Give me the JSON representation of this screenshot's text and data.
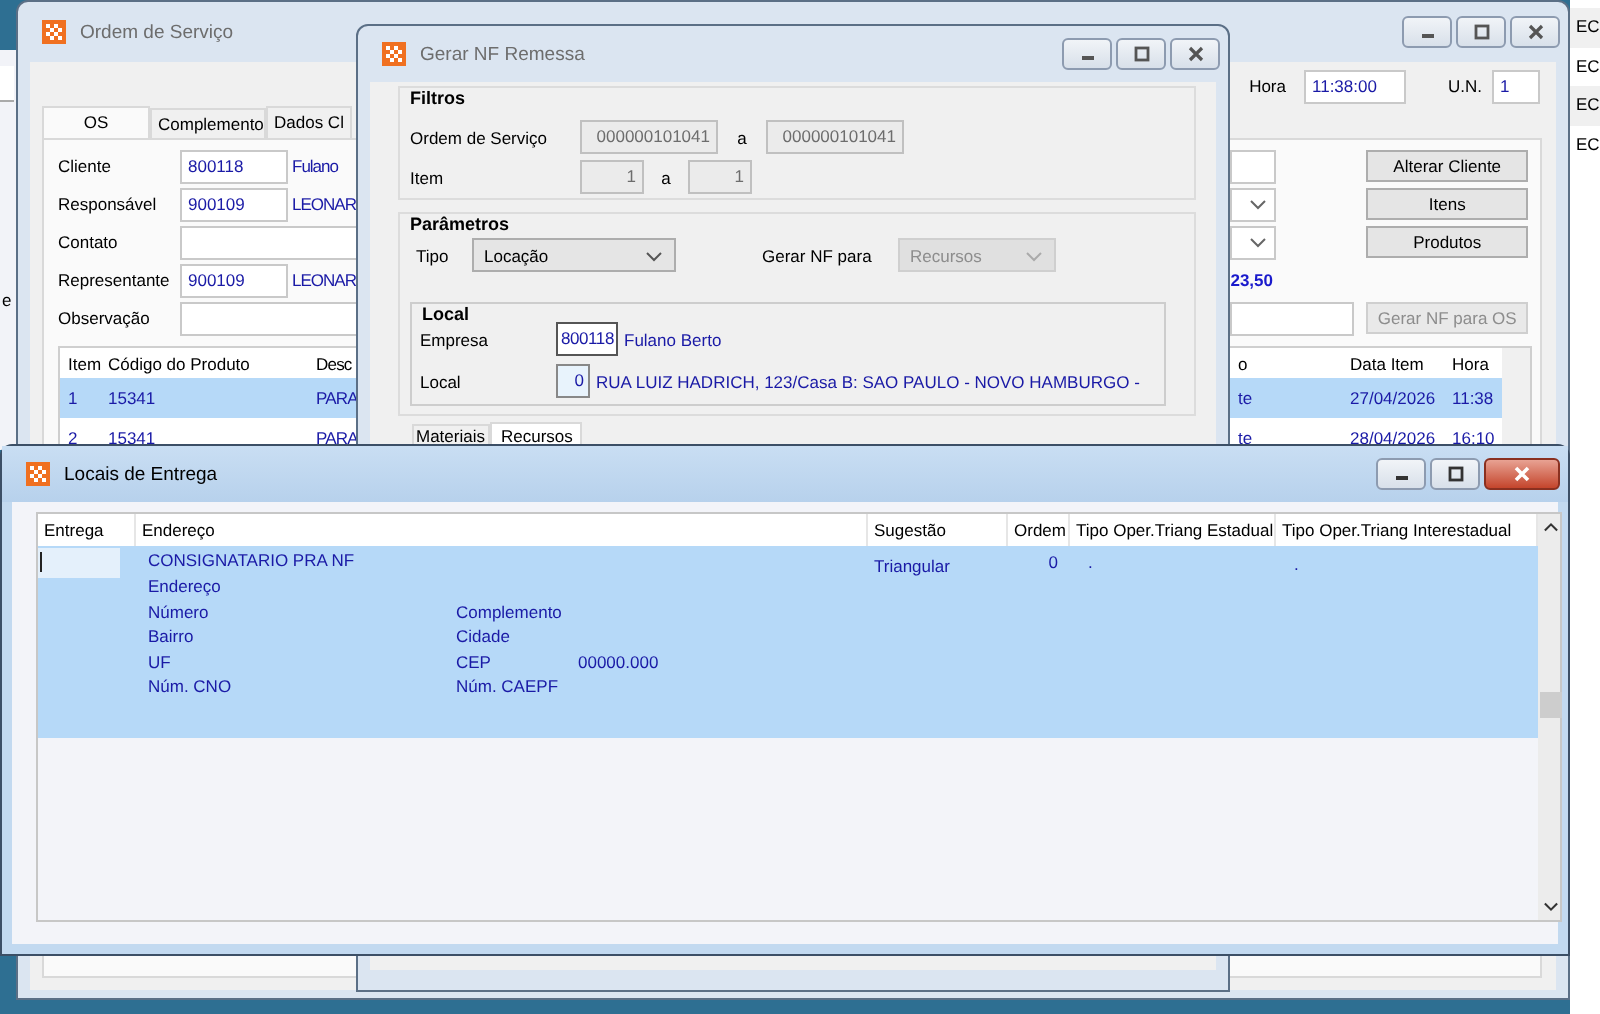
{
  "background_left": {
    "text": "e"
  },
  "background_right": {
    "rows": [
      "EC",
      "EC",
      "EC",
      "EC"
    ]
  },
  "main_window": {
    "title": "Ordem de Serviço",
    "hora_label": "Hora",
    "hora": "11:38:00",
    "un_label": "U.N.",
    "un": "1",
    "tabs": [
      {
        "label": "OS",
        "selected": true
      },
      {
        "label": "Complemento",
        "selected": false
      },
      {
        "label": "Dados Cl",
        "selected": false
      }
    ],
    "form": [
      {
        "label": "Cliente",
        "kind": "code",
        "value": "800118",
        "name": "Fulano",
        "side": {
          "kind": "field"
        }
      },
      {
        "label": "Responsável",
        "kind": "code",
        "value": "900109",
        "name": "LEONAR",
        "side": {
          "kind": "select"
        }
      },
      {
        "label": "Contato",
        "kind": "wide",
        "side": {
          "kind": "select"
        }
      },
      {
        "label": "Representante",
        "kind": "code",
        "value": "900109",
        "name": "LEONAR",
        "side": {
          "kind": "total",
          "text": "23,50"
        }
      },
      {
        "label": "Observação",
        "kind": "wide",
        "side": {
          "kind": "long-field"
        }
      }
    ],
    "buttons": [
      {
        "label": "Alterar Cliente",
        "disabled": false
      },
      {
        "label": "Itens",
        "disabled": false
      },
      {
        "label": "Produtos",
        "disabled": false
      },
      {
        "label": "Gerar NF para OS",
        "disabled": true
      }
    ],
    "grid": {
      "columns": [
        "Item",
        "Código do Produto",
        "Desc",
        "o",
        "Data Item",
        "Hora"
      ],
      "rows": [
        {
          "selected": true,
          "cells": [
            "1",
            "15341",
            "PARA",
            "te",
            "27/04/2026",
            "11:38"
          ]
        },
        {
          "selected": false,
          "cells": [
            "2",
            "15341",
            "PARA",
            "te",
            "28/04/2026",
            "16:10"
          ]
        }
      ]
    }
  },
  "dialog": {
    "title": "Gerar NF Remessa",
    "filters": {
      "title": "Filtros",
      "os_label": "Ordem de Serviço",
      "os_from": "000000101041",
      "sep": "a",
      "os_to": "000000101041",
      "item_label": "Item",
      "item_from": "1",
      "item_sep": "a",
      "item_to": "1"
    },
    "params": {
      "title": "Parâmetros",
      "tipo_label": "Tipo",
      "tipo": "Locação",
      "gerar_label": "Gerar NF para",
      "gerar": "Recursos",
      "gerar_disabled": true
    },
    "local": {
      "title": "Local",
      "empresa_label": "Empresa",
      "empresa_code": "800118",
      "empresa_name": "Fulano Berto",
      "local_label": "Local",
      "local_code": "0",
      "local_address": "RUA LUIZ HADRICH, 123/Casa B: SAO PAULO - NOVO HAMBURGO -"
    },
    "tabs": [
      {
        "label": "Materiais",
        "selected": false
      },
      {
        "label": "Recursos",
        "selected": true
      }
    ]
  },
  "locais": {
    "title": "Locais de Entrega",
    "columns": [
      "Entrega",
      "Endereço",
      "Sugestão",
      "Ordem",
      "Tipo Oper.Triang Estadual",
      "Tipo Oper.Triang Interestadual"
    ],
    "rows": [
      {
        "selected": true,
        "consignee": "CONSIGNATARIO PRA NF",
        "address": [
          [
            "Endereço"
          ],
          [
            "Número",
            "Complemento"
          ],
          [
            "Bairro",
            "Cidade"
          ],
          [
            "UF",
            "CEP",
            "00000.000"
          ],
          [
            "Núm. CNO",
            "Núm. CAEPF"
          ]
        ],
        "sugestao": "Triangular",
        "ordem": "0",
        "estadual": ".",
        "interestadual": "."
      }
    ]
  }
}
